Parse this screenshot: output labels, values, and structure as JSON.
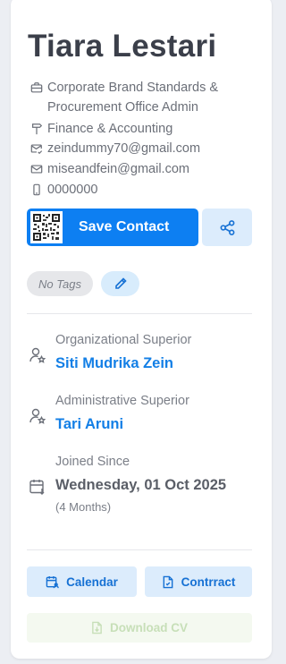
{
  "profile": {
    "name": "Tiara Lestari",
    "position": "Corporate Brand Standards & Procurement Office Admin",
    "department": "Finance & Accounting",
    "email_primary": "zeindummy70@gmail.com",
    "email_secondary": "miseandfein@gmail.com",
    "phone": "0000000"
  },
  "actions": {
    "save_contact": "Save Contact"
  },
  "tags": {
    "empty_label": "No Tags"
  },
  "superiors": {
    "organizational_label": "Organizational Superior",
    "organizational_name": "Siti Mudrika Zein",
    "administrative_label": "Administrative Superior",
    "administrative_name": "Tari Aruni"
  },
  "joined": {
    "label": "Joined Since",
    "date": "Wednesday, 01 Oct 2025",
    "duration": "(4 Months)"
  },
  "footer_buttons": {
    "calendar": "Calendar",
    "contract": "Contrract",
    "download_cv": "Download CV"
  },
  "colors": {
    "primary": "#0d7ff2",
    "primary_light": "#dcecfc",
    "link": "#137fe6",
    "disabled_green": "#c7dfb8"
  },
  "icons": {
    "position": "briefcase-icon",
    "department": "signpost-icon",
    "email_primary": "mail-check-icon",
    "email_secondary": "mail-icon",
    "phone": "phone-icon",
    "share": "share-icon",
    "edit": "pencil-icon",
    "superior": "user-star-icon",
    "joined": "calendar-arrow-icon",
    "calendar": "calendar-user-icon",
    "contract": "contract-icon",
    "cv": "file-download-icon"
  }
}
